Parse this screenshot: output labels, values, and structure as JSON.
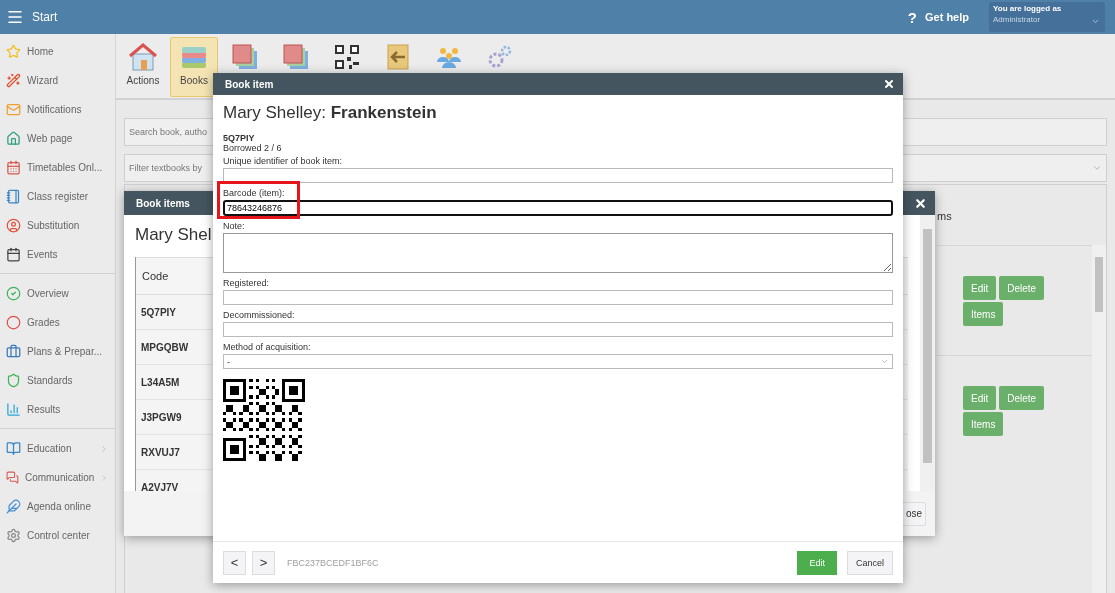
{
  "top_bar": {
    "title": "Start",
    "help_mark": "?",
    "help": "Get help",
    "user_label": "You are logged as",
    "user_name": "Administrator"
  },
  "sidebar": {
    "sections": [
      {
        "items": [
          {
            "label": "Home",
            "has_submenu": false
          },
          {
            "label": "Wizard",
            "has_submenu": false
          },
          {
            "label": "Notifications",
            "has_submenu": false
          },
          {
            "label": "Web page",
            "has_submenu": false
          },
          {
            "label": "Timetables Onl...",
            "has_submenu": false
          },
          {
            "label": "Class register",
            "has_submenu": false
          },
          {
            "label": "Substitution",
            "has_submenu": false
          },
          {
            "label": "Events",
            "has_submenu": false
          }
        ]
      },
      {
        "items": [
          {
            "label": "Overview",
            "has_submenu": false
          },
          {
            "label": "Grades",
            "has_submenu": false
          },
          {
            "label": "Plans & Prepar...",
            "has_submenu": false
          },
          {
            "label": "Standards",
            "has_submenu": false
          },
          {
            "label": "Results",
            "has_submenu": false
          }
        ]
      },
      {
        "items": [
          {
            "label": "Education",
            "has_submenu": true
          },
          {
            "label": "Communication",
            "has_submenu": true
          },
          {
            "label": "Agenda online",
            "has_submenu": false
          },
          {
            "label": "Control center",
            "has_submenu": false
          }
        ]
      }
    ]
  },
  "toolbar": {
    "items": [
      {
        "label": "Actions",
        "selected": false
      },
      {
        "label": "Books",
        "selected": true
      },
      {
        "selected": false
      },
      {
        "selected": false
      },
      {
        "selected": false
      },
      {
        "selected": false
      },
      {
        "selected": false
      },
      {
        "selected": false
      }
    ]
  },
  "search": {
    "placeholder": "Search book, autho"
  },
  "filter": {
    "placeholder": "Filter textbooks by"
  },
  "books_panel": {
    "heading": "ms",
    "rows": [
      {
        "buttons": [
          "Edit",
          "Delete",
          "Items"
        ]
      },
      {
        "buttons": [
          "Edit",
          "Delete",
          "Items"
        ]
      }
    ]
  },
  "book_items_dialog": {
    "title": "Book items",
    "heading": "Mary Shel",
    "column": "Code",
    "rows": [
      "5Q7PIY",
      "MPGQBW",
      "L34A5M",
      "J3PGW9",
      "RXVUJ7",
      "A2VJ7V"
    ],
    "close_button": "ose"
  },
  "book_item_dialog": {
    "title": "Book item",
    "heading": "Mary Shelley: **Frankenstein**",
    "code": "5Q7PIY",
    "borrowed": "Borrowed 2 / 6",
    "fields": [
      {
        "kind": "text",
        "label": "Unique identifier of book item:",
        "focused": false,
        "highlighted": false
      },
      {
        "kind": "text",
        "label": "Barcode (item):",
        "value": "78643246876",
        "focused": true,
        "highlighted": true
      },
      {
        "kind": "textarea",
        "label": "Note:",
        "focused": false,
        "highlighted": false
      },
      {
        "kind": "text",
        "label": "Registered:",
        "focused": false,
        "highlighted": false
      },
      {
        "kind": "text",
        "label": "Decommissioned:",
        "focused": false,
        "highlighted": false
      },
      {
        "kind": "select",
        "label": "Method of acquisition:",
        "value": "-",
        "focused": false,
        "highlighted": false
      }
    ],
    "prev": "<",
    "next": ">",
    "hash": "FBC237BCEDF1BF6C",
    "buttons": [
      {
        "label": "Edit",
        "primary": true
      },
      {
        "label": "Cancel",
        "primary": false
      }
    ]
  }
}
